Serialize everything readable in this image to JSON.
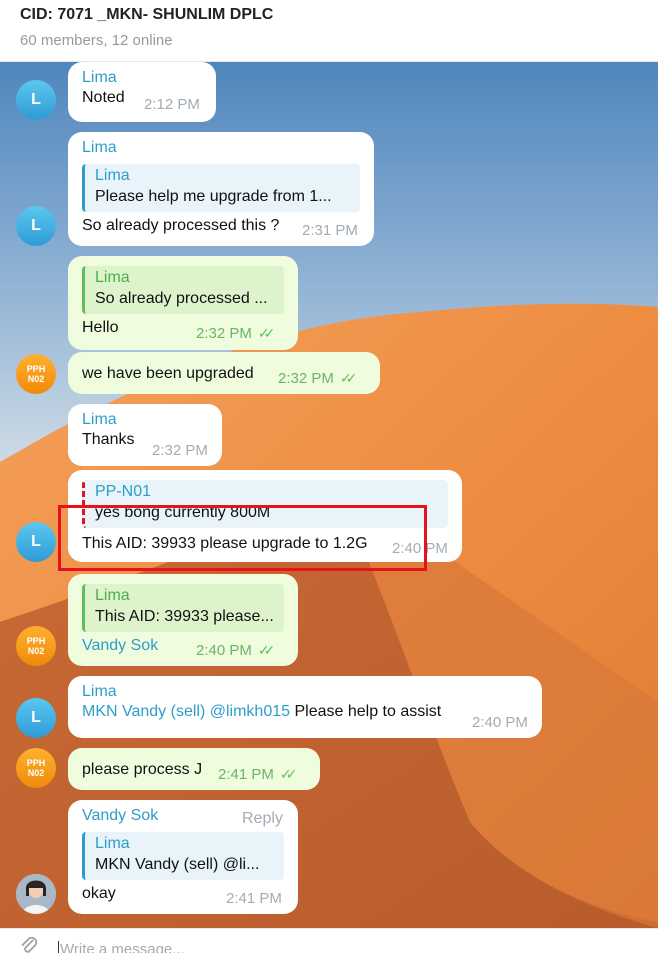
{
  "header": {
    "title": "CID: 7071 _MKN- SHUNLIM DPLC",
    "subtitle": "60 members, 12 online"
  },
  "avatars": {
    "lima": "L",
    "pph_line1": "PPH",
    "pph_line2": "N02"
  },
  "messages": [
    {
      "sender": "Lima",
      "text": "Noted",
      "time": "2:12 PM"
    },
    {
      "sender": "Lima",
      "quote_name": "Lima",
      "quote_text": "Please help me upgrade from 1...",
      "text": "So already processed this ?",
      "time": "2:31 PM"
    },
    {
      "sender": "Lima",
      "quote_name": "Lima",
      "quote_text": "So already processed ...",
      "text": "Hello",
      "time": "2:32 PM"
    },
    {
      "text": "we have been upgraded",
      "time": "2:32 PM"
    },
    {
      "sender": "Lima",
      "text": "Thanks",
      "time": "2:32 PM"
    },
    {
      "quote_name": "PP-N01",
      "quote_text": "yes bong currently 800M",
      "text": "This AID: 39933 please upgrade to 1.2G",
      "time": "2:40 PM"
    },
    {
      "quote_name": "Lima",
      "quote_text": "This AID: 39933 please...",
      "text": "Vandy Sok",
      "time": "2:40 PM"
    },
    {
      "sender": "Lima",
      "mention1": "MKN Vandy (sell)",
      "mention2": "@limkh015",
      "text": "Please help to assist",
      "time": "2:40 PM"
    },
    {
      "text": "please process J",
      "time": "2:41 PM"
    },
    {
      "sender": "Vandy Sok",
      "reply": "Reply",
      "quote_name": "Lima",
      "quote_text": "MKN Vandy (sell)  @li...",
      "text": "okay",
      "time": "2:41 PM"
    }
  ],
  "composer": {
    "placeholder": "Write a message..."
  },
  "colors": {
    "accent": "#2d9dca",
    "outgoing_bubble": "#effdde",
    "highlight": "#e8111e"
  }
}
